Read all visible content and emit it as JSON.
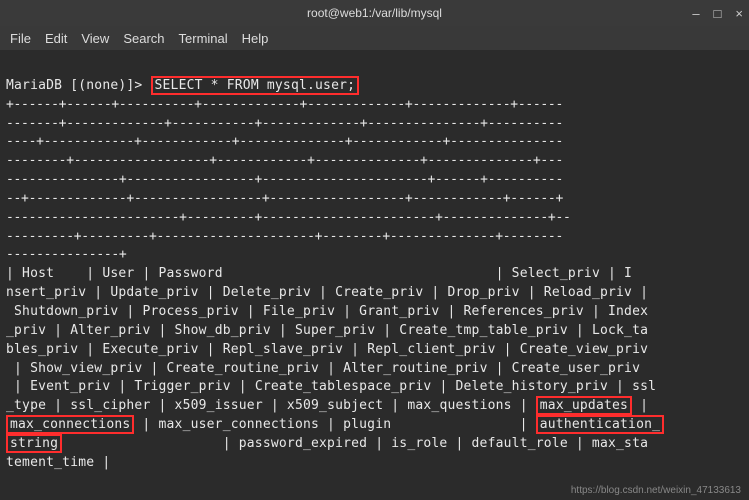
{
  "window": {
    "title": "root@web1:/var/lib/mysql",
    "min": "–",
    "max": "□",
    "close": "×"
  },
  "menu": {
    "file": "File",
    "edit": "Edit",
    "view": "View",
    "search": "Search",
    "terminal": "Terminal",
    "help": "Help"
  },
  "term": {
    "prompt": "MariaDB [(none)]>",
    "query": "SELECT * FROM mysql.user;",
    "sep1": "+------+------+----------+-------------+-------------+-------------+------",
    "sep2": "-------+-------------+-----------+-------------+---------------+----------",
    "sep3": "----+------------+------------+--------------+------------+---------------",
    "sep4": "--------+------------------+------------+--------------+--------------+---",
    "sep5": "---------------+-----------------+----------------------+------+----------",
    "sep6": "--+-------------+-----------------+------------------+------------+------+",
    "sep7": "-----------------------+---------+-----------------------+--------------+--",
    "sep8": "---------+---------+---------------------+--------+--------------+--------",
    "sep9": "---------------+",
    "cols_l1": "| Host    | User | Password                                  | Select_priv | I",
    "cols_l2": "nsert_priv | Update_priv | Delete_priv | Create_priv | Drop_priv | Reload_priv |",
    "cols_l3": " Shutdown_priv | Process_priv | File_priv | Grant_priv | References_priv | Index",
    "cols_l4": "_priv | Alter_priv | Show_db_priv | Super_priv | Create_tmp_table_priv | Lock_ta",
    "cols_l5": "bles_priv | Execute_priv | Repl_slave_priv | Repl_client_priv | Create_view_priv",
    "cols_l6": " | Show_view_priv | Create_routine_priv | Alter_routine_priv | Create_user_priv",
    "cols_l7": " | Event_priv | Trigger_priv | Create_tablespace_priv | Delete_history_priv | ssl",
    "cols_l8a": "_type | ssl_cipher | x509_issuer | x509_subject | max_questions | ",
    "cols_l8b": "max_updates",
    "cols_l8c": " | ",
    "cols_l9a": "max_connections",
    "cols_l9b": " | max_user_connections | plugin                | ",
    "cols_l9c": "authentication_",
    "cols_l10a": "string",
    "cols_l10b": "                    | password_expired | is_role | default_role | max_sta",
    "cols_l11": "tement_time |"
  },
  "watermark": "https://blog.csdn.net/weixin_47133613"
}
